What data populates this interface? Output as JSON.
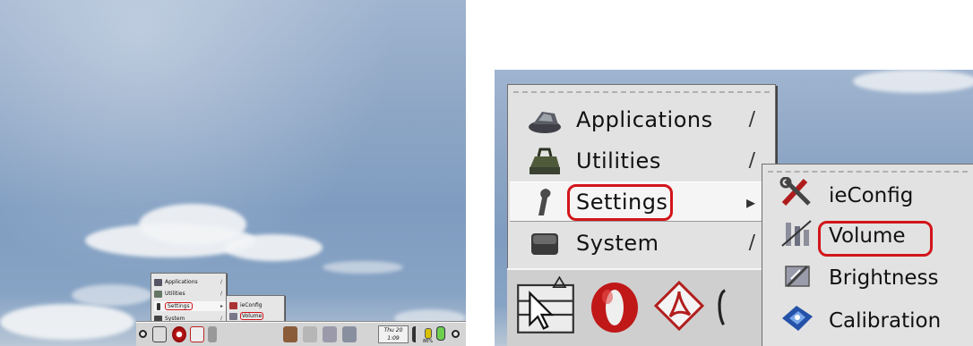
{
  "menu": {
    "items": [
      {
        "label": "Applications",
        "icon": "applications-icon",
        "has_submenu": true
      },
      {
        "label": "Utilities",
        "icon": "utilities-icon",
        "has_submenu": true
      },
      {
        "label": "Settings",
        "icon": "settings-icon",
        "has_submenu": true,
        "active": true,
        "circled": true
      },
      {
        "label": "System",
        "icon": "system-icon",
        "has_submenu": true
      }
    ]
  },
  "settings_submenu": {
    "items": [
      {
        "label": "ieConfig",
        "icon": "ieconfig-icon"
      },
      {
        "label": "Volume",
        "icon": "volume-icon",
        "circled": true
      },
      {
        "label": "Brightness",
        "icon": "brightness-icon"
      },
      {
        "label": "Calibration",
        "icon": "calibration-icon"
      }
    ]
  },
  "panel": {
    "clock_day": "Thu 20",
    "clock_time": "1:09",
    "battery_text": "86%",
    "launchers": [
      "terminal-icon",
      "opera-icon",
      "acrobat-icon",
      "app-icon"
    ]
  },
  "colors": {
    "highlight_ring": "#d2151a",
    "menu_bg": "#e2e2e2",
    "panel_bg": "#cfcfcf"
  }
}
